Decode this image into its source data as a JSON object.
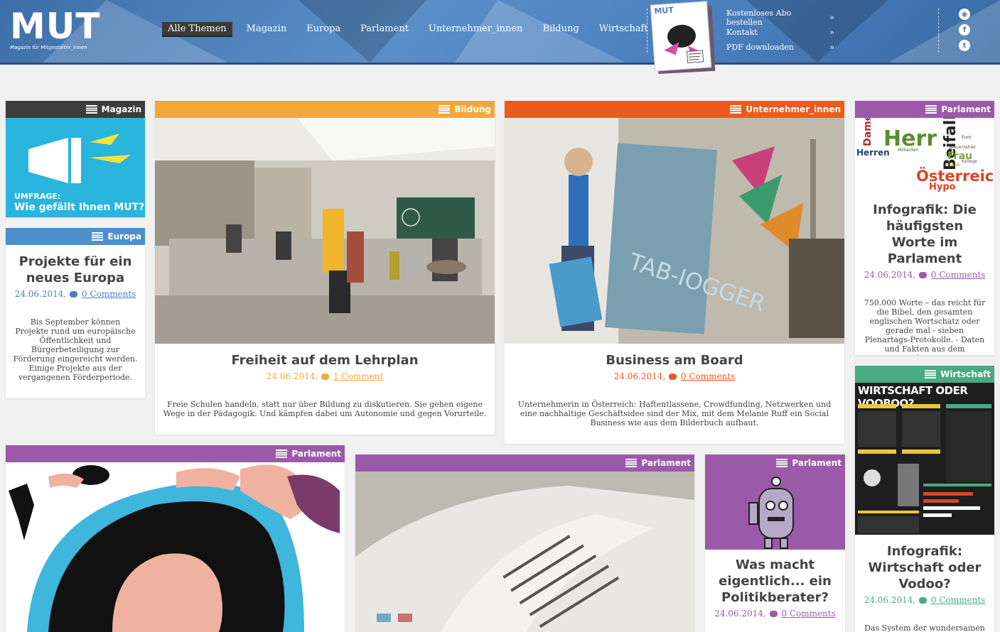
{
  "header": {
    "logo": "MUT",
    "logo_sub": "Magazin für Mitgestalter_innen",
    "nav": [
      "Alle Themen",
      "Magazin",
      "Europa",
      "Parlament",
      "Unternehmer_innen",
      "Bildung",
      "Wirtschaft"
    ],
    "cover_logo": "MUT",
    "side_links": [
      {
        "label": "Kostenloses Abo bestellen",
        "arrow": "»"
      },
      {
        "label": "Kontakt",
        "arrow": "»"
      },
      {
        "label": "PDF downloaden",
        "arrow": "»"
      }
    ],
    "social": [
      {
        "icon": "rss-icon",
        "glyph": "◉"
      },
      {
        "icon": "facebook-icon",
        "glyph": "f"
      },
      {
        "icon": "twitter-icon",
        "glyph": "t"
      }
    ]
  },
  "cards": {
    "magazin": {
      "category": "Magazin",
      "promo_small": "UMFRAGE:",
      "promo_big": "Wie gefällt Ihnen MUT?"
    },
    "europa": {
      "category": "Europa",
      "title": "Projekte für ein neues Europa",
      "date": "24.06.2014,",
      "comments": "0 Comments",
      "excerpt": "Bis September können Projekte rund um europäische Öffentlichkeit und Bürgerbeteiligung zur Förderung eingereicht werden. Einige Projekte aus der vergangenen Förderperiode."
    },
    "bildung": {
      "category": "Bildung",
      "title": "Freiheit auf dem Lehrplan",
      "date": "24.06.2014,",
      "comments": "1 Comment",
      "excerpt": "Freie Schulen handeln, statt nur über Bildung zu diskutieren. Sie gehen eigene Wege in der Pädagogik. Und kämpfen dabei um Autonomie und gegen Vorurteile."
    },
    "unternehmer": {
      "category": "Unternehmer_innen",
      "title": "Business am Board",
      "date": "24.06.2014,",
      "comments": "0 Comments",
      "excerpt": "Unternehmerin in Österreich: Haftentlassene, Crowdfunding, Netzwerken und eine nachhaltige Geschäftsidee sind der Mix, mit dem Melanie Ruff ein Social Business wie aus dem Bilderbuch aufbaut."
    },
    "parlament_info": {
      "category": "Parlament",
      "title": "Infografik: Die häufigsten Worte im Parlament",
      "date": "24.06.2014,",
      "comments": "0 Comments",
      "excerpt": "750.000 Worte – das reicht für die Bibel, den gesamten englischen Wortschatz oder gerade mal - sieben Plenartags-Protokolle. - Daten und Fakten aus dem Parlament.",
      "words": [
        "Herr",
        "Damen",
        "Beifall",
        "Herren",
        "Frau",
        "Österreich",
        "Hypo",
        "Steuerzahler",
        "Bank",
        "Kollege",
        "Milliarden",
        "Euro"
      ]
    },
    "wirtschaft": {
      "category": "Wirtschaft",
      "image_title": "WIRTSCHAFT ODER VOOBOO?",
      "title": "Infografik: Wirtschaft oder Vodoo?",
      "date": "24.06.2014,",
      "comments": "0 Comments",
      "excerpt": "Das System der wundersamen"
    },
    "parlament_a": {
      "category": "Parlament"
    },
    "parlament_b": {
      "category": "Parlament"
    },
    "parlament_c": {
      "category": "Parlament",
      "title": "Was macht eigentlich... ein Politikberater?",
      "date": "24.06.2014,",
      "comments": "0 Comments"
    }
  },
  "colors": {
    "header": "#4a7fbd",
    "magazin": "#3d3d3d",
    "bildung": "#f4a83a",
    "unternehmer": "#ee5a1e",
    "parlament": "#9a5aa9",
    "europa": "#4e8fcc",
    "wirtschaft": "#4aaa82",
    "date": "#d9a44a",
    "link": "#4a7fbd"
  }
}
